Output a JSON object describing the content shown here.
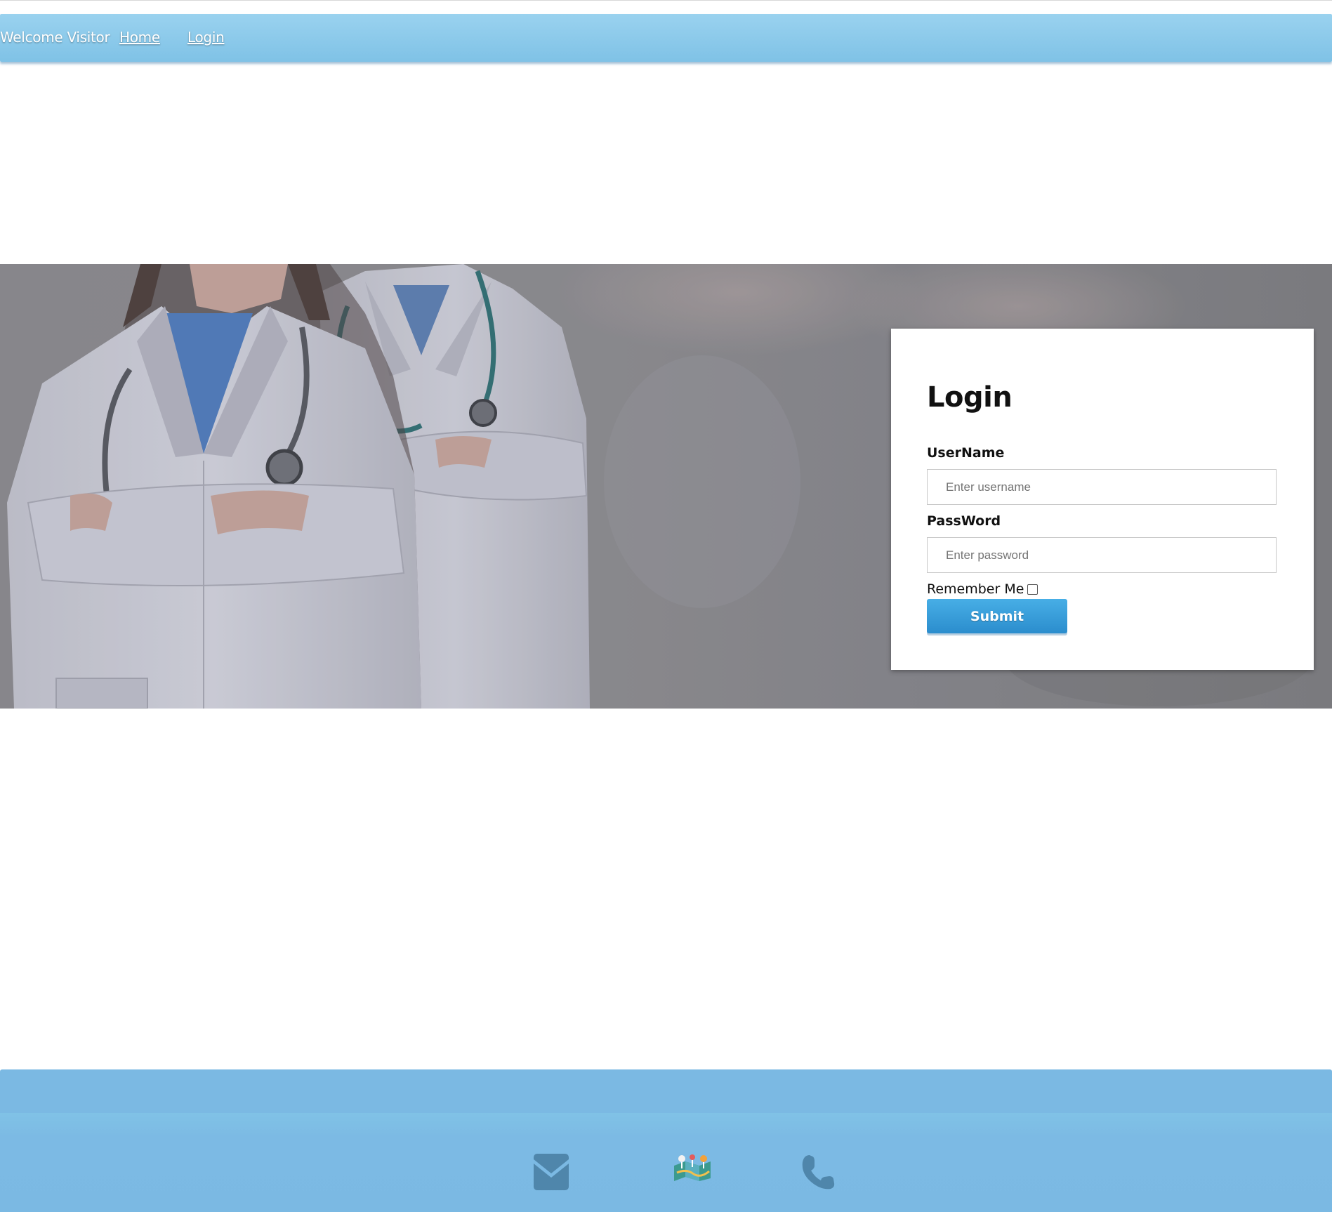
{
  "navbar": {
    "welcome": "Welcome Visitor",
    "home_link": "Home",
    "login_link": "Login"
  },
  "login_form": {
    "title": "Login",
    "username_label": "UserName",
    "username_placeholder": "Enter username",
    "password_label": "PassWord",
    "password_placeholder": "Enter password",
    "remember_label": "Remember Me",
    "remember_checked": false,
    "submit_label": "Submit"
  },
  "hero": {
    "image": "two-doctors-in-white-coats-with-stethoscopes"
  },
  "footer": {
    "icons": [
      "envelope-icon",
      "map-icon",
      "phone-icon"
    ]
  },
  "colors": {
    "navbar": "#8ccbec",
    "footer": "#7bb9e3",
    "submit_button": "#3a9fdb"
  }
}
